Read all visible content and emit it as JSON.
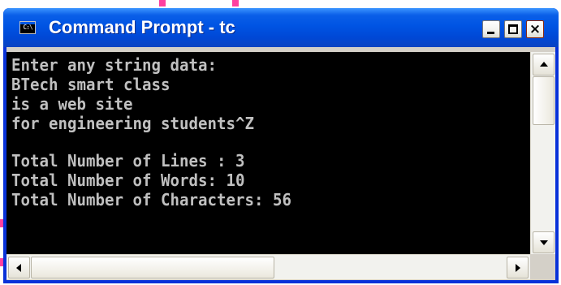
{
  "window": {
    "title": "Command Prompt - tc",
    "icon": "cmd-icon",
    "icon_text": "C:\\"
  },
  "controls": {
    "minimize": "minimize-icon",
    "maximize": "maximize-icon",
    "close": "close-icon",
    "close_glyph": "×"
  },
  "console": {
    "lines": [
      "Enter any string data:",
      "BTech smart class",
      "is a web site",
      "for engineering students^Z",
      "",
      "Total Number of Lines : 3",
      "Total Number of Words: 10",
      "Total Number of Characters: 56"
    ],
    "colors": {
      "background": "#000000",
      "text": "#c0c0c0"
    }
  },
  "theme": {
    "titlebar": "#0054e3",
    "frame": "#0831d9",
    "scrollbar": "#f2f2ee"
  }
}
